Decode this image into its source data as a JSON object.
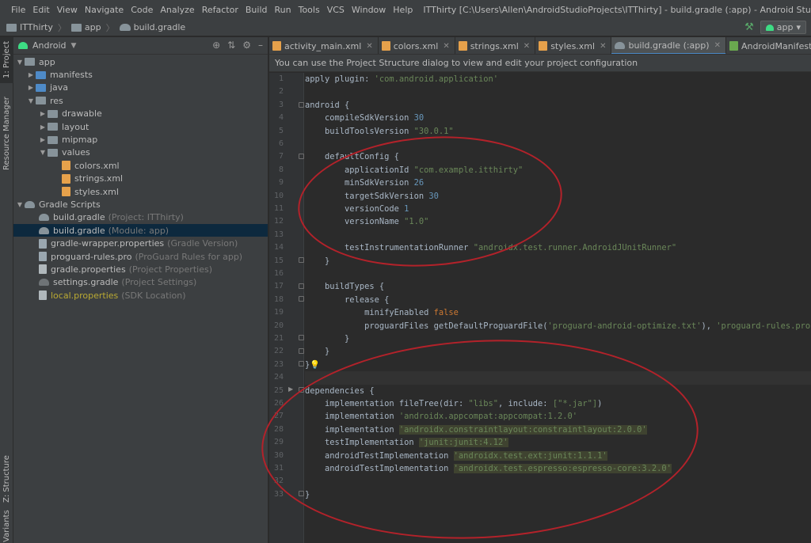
{
  "menubar": {
    "items": [
      "File",
      "Edit",
      "View",
      "Navigate",
      "Code",
      "Analyze",
      "Refactor",
      "Build",
      "Run",
      "Tools",
      "VCS",
      "Window",
      "Help"
    ],
    "window_title": "ITThirty [C:\\Users\\Allen\\AndroidStudioProjects\\ITThirty] - build.gradle (:app) - Android Studio"
  },
  "navbar": {
    "breadcrumbs": [
      "ITThirty",
      "app",
      "build.gradle"
    ],
    "run_config": "app"
  },
  "toolstrip": {
    "tabs": [
      "1: Project",
      "Resource Manager",
      "Z: Structure",
      "Variants"
    ]
  },
  "project": {
    "view_mode": "Android",
    "tree": [
      {
        "label": "app",
        "hint": ""
      },
      {
        "label": "manifests",
        "hint": ""
      },
      {
        "label": "java",
        "hint": ""
      },
      {
        "label": "res",
        "hint": ""
      },
      {
        "label": "drawable",
        "hint": ""
      },
      {
        "label": "layout",
        "hint": ""
      },
      {
        "label": "mipmap",
        "hint": ""
      },
      {
        "label": "values",
        "hint": ""
      },
      {
        "label": "colors.xml",
        "hint": ""
      },
      {
        "label": "strings.xml",
        "hint": ""
      },
      {
        "label": "styles.xml",
        "hint": ""
      },
      {
        "label": "Gradle Scripts",
        "hint": ""
      },
      {
        "label": "build.gradle",
        "hint": "(Project: ITThirty)"
      },
      {
        "label": "build.gradle",
        "hint": "(Module: app)"
      },
      {
        "label": "gradle-wrapper.properties",
        "hint": "(Gradle Version)"
      },
      {
        "label": "proguard-rules.pro",
        "hint": "(ProGuard Rules for app)"
      },
      {
        "label": "gradle.properties",
        "hint": "(Project Properties)"
      },
      {
        "label": "settings.gradle",
        "hint": "(Project Settings)"
      },
      {
        "label": "local.properties",
        "hint": "(SDK Location)"
      }
    ]
  },
  "tabs": [
    {
      "label": "activity_main.xml"
    },
    {
      "label": "colors.xml"
    },
    {
      "label": "strings.xml"
    },
    {
      "label": "styles.xml"
    },
    {
      "label": "build.gradle (:app)"
    },
    {
      "label": "AndroidManifest.xml"
    },
    {
      "label": "M"
    }
  ],
  "notice": "You can use the Project Structure dialog to view and edit your project configuration",
  "editor": {
    "line_numbers": [
      "1",
      "2",
      "3",
      "4",
      "5",
      "6",
      "7",
      "8",
      "9",
      "10",
      "11",
      "12",
      "13",
      "14",
      "15",
      "16",
      "17",
      "18",
      "19",
      "20",
      "21",
      "22",
      "23",
      "24",
      "25",
      "26",
      "27",
      "28",
      "29",
      "30",
      "31",
      "32",
      "33"
    ],
    "lines": {
      "l1_a": "apply plugin: ",
      "l1_b": "'com.android.application'",
      "l3": "android {",
      "l4_a": "    compileSdkVersion ",
      "l4_b": "30",
      "l5_a": "    buildToolsVersion ",
      "l5_b": "\"30.0.1\"",
      "l7": "    defaultConfig {",
      "l8_a": "        applicationId ",
      "l8_b": "\"com.example.itthirty\"",
      "l9_a": "        minSdkVersion ",
      "l9_b": "26",
      "l10_a": "        targetSdkVersion ",
      "l10_b": "30",
      "l11_a": "        versionCode ",
      "l11_b": "1",
      "l12_a": "        versionName ",
      "l12_b": "\"1.0\"",
      "l14_a": "        testInstrumentationRunner ",
      "l14_b": "\"androidx.test.runner.AndroidJUnitRunner\"",
      "l15": "    }",
      "l17": "    buildTypes {",
      "l18": "        release {",
      "l19_a": "            minifyEnabled ",
      "l19_b": "false",
      "l20_a": "            proguardFiles getDefaultProguardFile(",
      "l20_b": "'proguard-android-optimize.txt'",
      "l20_c": "), ",
      "l20_d": "'proguard-rules.pro'",
      "l21": "        }",
      "l22": "    }",
      "l23": "}",
      "l25": "dependencies {",
      "l26_a": "    implementation fileTree(",
      "l26_b": "dir: ",
      "l26_c": "\"libs\"",
      "l26_d": ", ",
      "l26_e": "include: ",
      "l26_f": "[\"*.jar\"]",
      "l26_g": ")",
      "l27_a": "    implementation ",
      "l27_b": "'androidx.appcompat:appcompat:1.2.0'",
      "l28_a": "    implementation ",
      "l28_b": "'androidx.constraintlayout:constraintlayout:2.0.0'",
      "l29_a": "    testImplementation ",
      "l29_b": "'junit:junit:4.12'",
      "l30_a": "    androidTestImplementation ",
      "l30_b": "'androidx.test.ext:junit:1.1.1'",
      "l31_a": "    androidTestImplementation ",
      "l31_b": "'androidx.test.espresso:espresso-core:3.2.0'",
      "l33": "}"
    }
  },
  "colors": {
    "annotation": "#b3222a",
    "selection": "#0d293e",
    "keyword": "#cc7832",
    "string": "#6a8759",
    "number": "#6897bb"
  }
}
